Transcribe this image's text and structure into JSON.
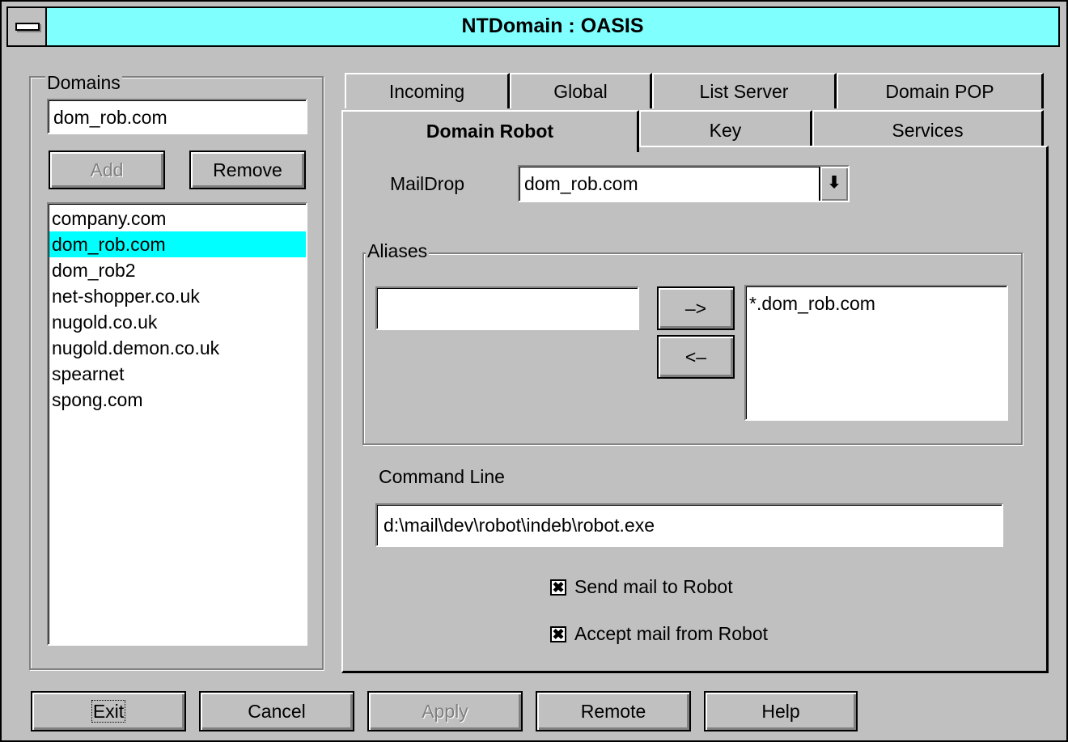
{
  "window": {
    "title": "NTDomain : OASIS"
  },
  "domains": {
    "group_label": "Domains",
    "input_value": "dom_rob.com",
    "add_label": "Add",
    "remove_label": "Remove",
    "items": [
      "company.com",
      "dom_rob.com",
      "dom_rob2",
      "net-shopper.co.uk",
      "nugold.co.uk",
      "nugold.demon.co.uk",
      "spearnet",
      "spong.com"
    ],
    "selected_index": 1
  },
  "tabs": {
    "row1": [
      "Incoming",
      "Global",
      "List Server",
      "Domain POP"
    ],
    "row2": [
      "Domain Robot",
      "Key",
      "Services"
    ],
    "active": "Domain Robot"
  },
  "robot": {
    "maildrop_label": "MailDrop",
    "maildrop_value": "dom_rob.com",
    "dropdown_glyph": "⬇",
    "aliases_label": "Aliases",
    "alias_input_value": "",
    "move_right_label": "–>",
    "move_left_label": "<–",
    "alias_list": [
      "*.dom_rob.com"
    ],
    "command_line_label": "Command Line",
    "command_line_value": "d:\\mail\\dev\\robot\\indeb\\robot.exe",
    "send_mail_label": "Send mail to Robot",
    "send_mail_checked": true,
    "accept_mail_label": "Accept mail from Robot",
    "accept_mail_checked": true,
    "check_glyph": "✖"
  },
  "footer": {
    "exit_label": "Exit",
    "cancel_label": "Cancel",
    "apply_label": "Apply",
    "remote_label": "Remote",
    "help_label": "Help"
  }
}
